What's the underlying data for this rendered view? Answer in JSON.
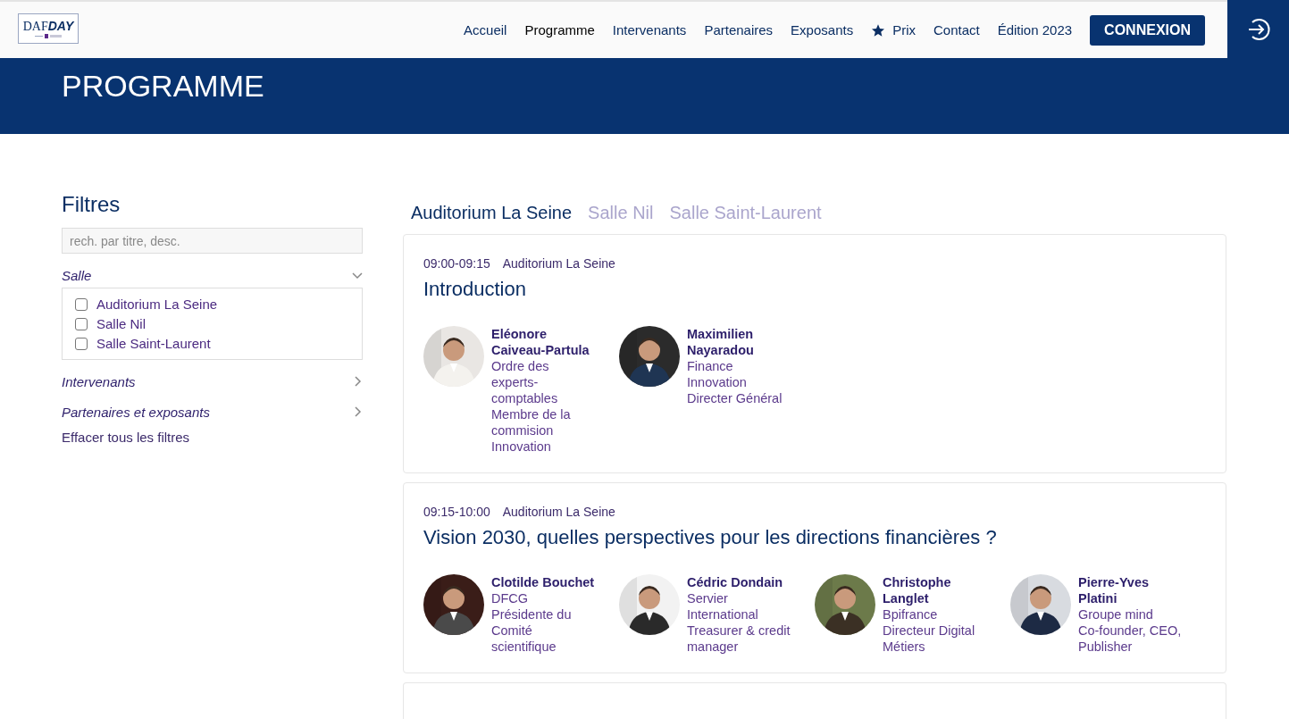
{
  "logo": {
    "part_1": "DAF",
    "part_2": "DAY"
  },
  "nav": [
    {
      "label": "Accueil",
      "kind": "link",
      "selected": false
    },
    {
      "label": "Programme",
      "kind": "link",
      "selected": true
    },
    {
      "label": "Intervenants",
      "kind": "link",
      "selected": false
    },
    {
      "label": "Partenaires",
      "kind": "link",
      "selected": false
    },
    {
      "label": "Exposants",
      "kind": "link",
      "selected": false
    },
    {
      "label": "Prix",
      "kind": "star",
      "selected": false
    },
    {
      "label": "Contact",
      "kind": "link",
      "selected": false
    },
    {
      "label": "Édition 2023",
      "kind": "link",
      "selected": false
    }
  ],
  "login_button": "CONNEXION",
  "page_title": "PROGRAMME",
  "filters": {
    "title": "Filtres",
    "search": {
      "placeholder": "rech. par titre, desc."
    },
    "sections": [
      {
        "label": "Salle",
        "expanded": true,
        "options": [
          {
            "label": "Auditorium La Seine",
            "checked": false
          },
          {
            "label": "Salle Nil",
            "checked": false
          },
          {
            "label": "Salle Saint-Laurent",
            "checked": false
          }
        ]
      },
      {
        "label": "Intervenants",
        "expanded": false
      },
      {
        "label": "Partenaires et exposants",
        "expanded": false
      }
    ],
    "clear_link": "Effacer tous les filtres"
  },
  "room_tabs": [
    {
      "label": "Auditorium La Seine",
      "selected": true
    },
    {
      "label": "Salle Nil",
      "selected": false
    },
    {
      "label": "Salle Saint-Laurent",
      "selected": false
    }
  ],
  "sessions": [
    {
      "time": "09:00-09:15",
      "room": "Auditorium La Seine",
      "title": "Introduction",
      "speakers": [
        {
          "name": "Eléonore Caiveau-Partula",
          "details": [
            "Ordre des experts-comptables",
            "Membre de la commision Innovation"
          ]
        },
        {
          "name": "Maximilien Nayaradou",
          "details": [
            "Finance Innovation",
            "Directer Général"
          ]
        }
      ]
    },
    {
      "time": "09:15-10:00",
      "room": "Auditorium La Seine",
      "title": "Vision 2030, quelles perspectives pour les directions financières ?",
      "speakers": [
        {
          "name": "Clotilde Bouchet",
          "details": [
            "DFCG",
            "Présidente du Comité scientifique"
          ]
        },
        {
          "name": "Cédric Dondain",
          "details": [
            "Servier International",
            "Treasurer & credit manager"
          ]
        },
        {
          "name": "Christophe Langlet",
          "details": [
            "Bpifrance",
            "Directeur Digital Métiers"
          ]
        },
        {
          "name": "Pierre-Yves Platini",
          "details": [
            "Groupe mind",
            "Co-founder, CEO, Publisher"
          ]
        }
      ]
    }
  ]
}
